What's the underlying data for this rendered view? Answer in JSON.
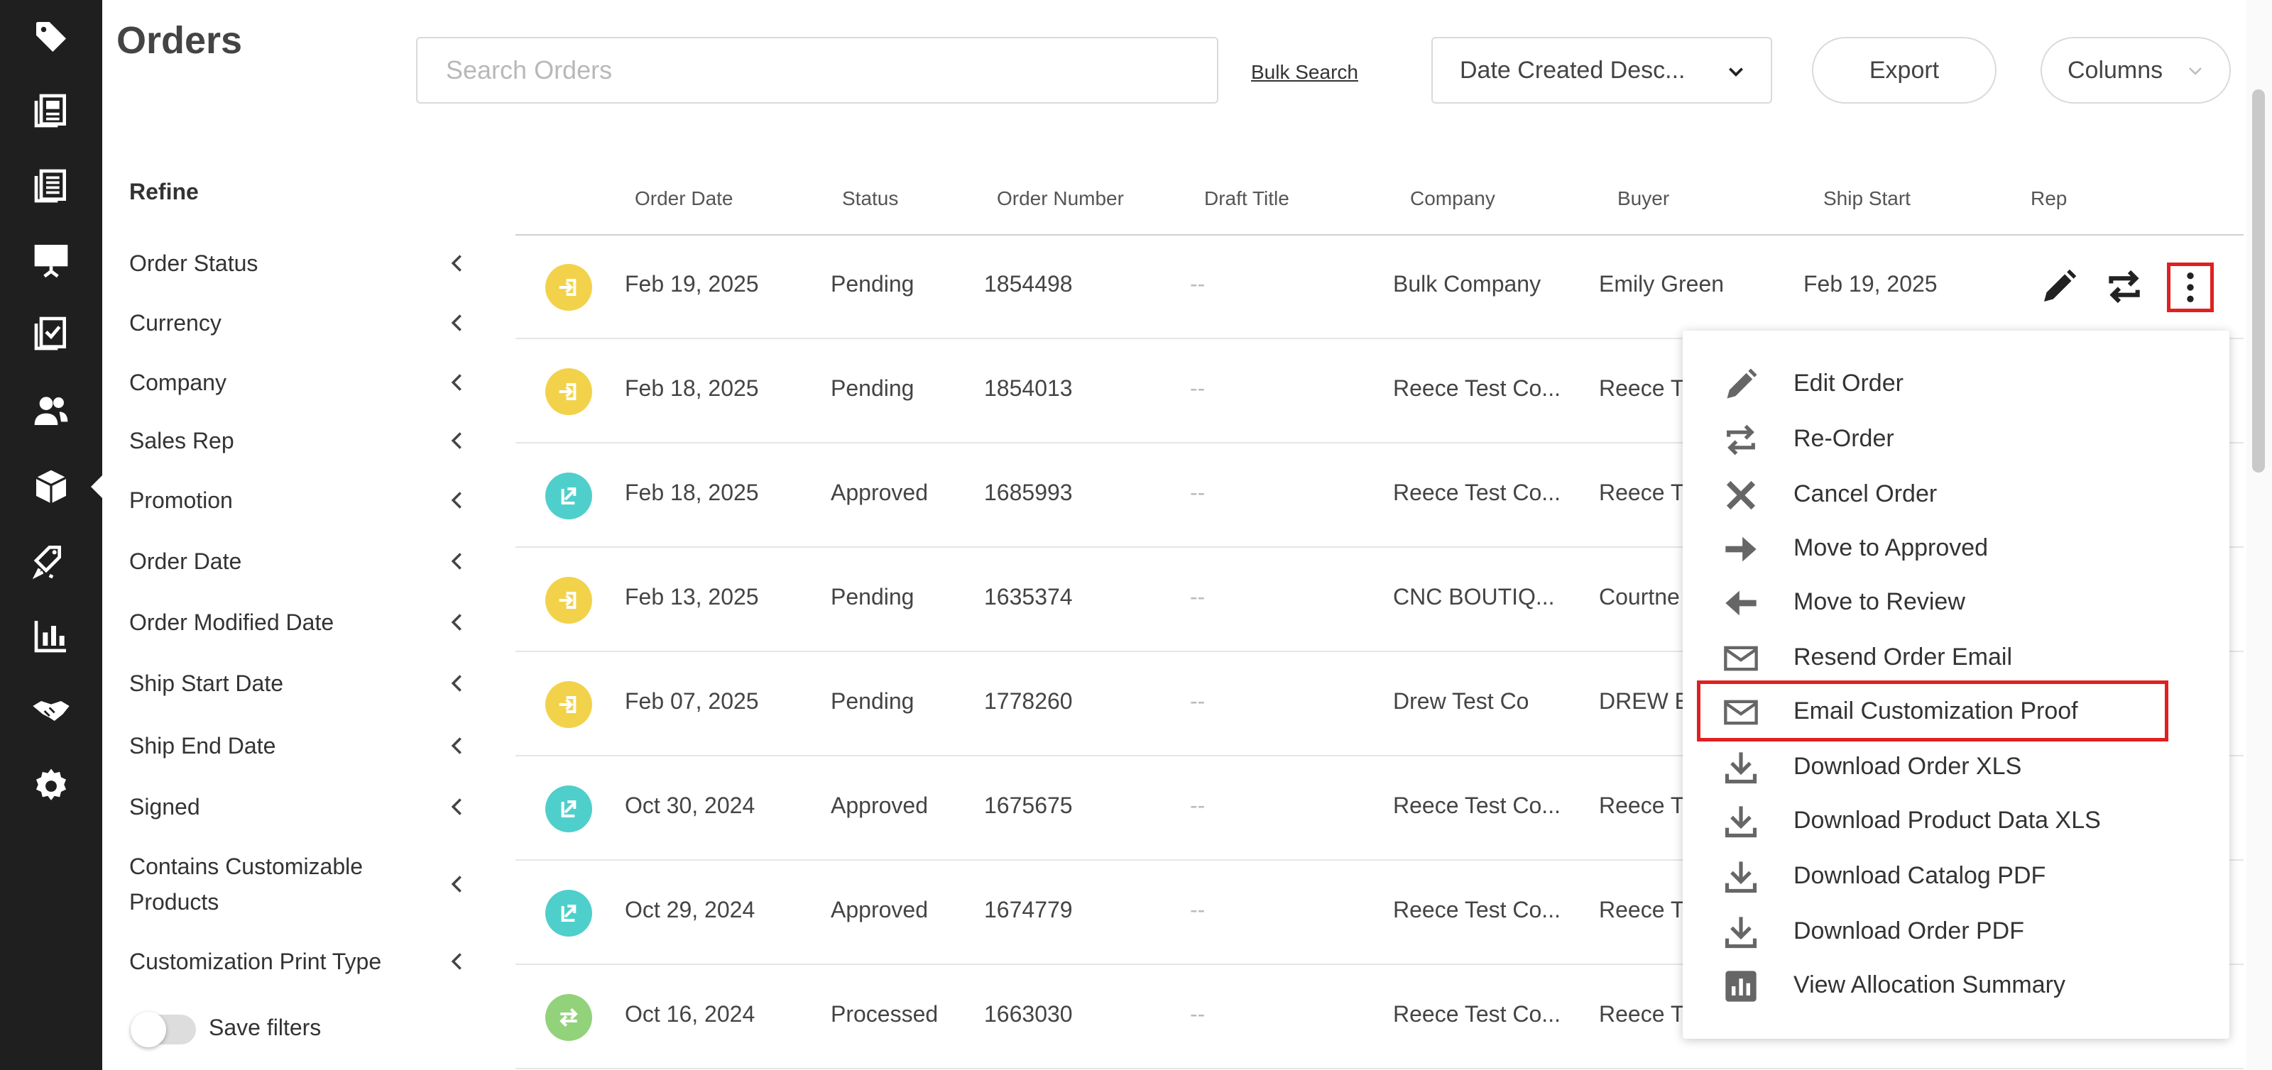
{
  "header": {
    "title": "Orders",
    "search_placeholder": "Search Orders",
    "search_value": "",
    "bulk_search": "Bulk Search",
    "sort_value": "Date Created Desc...",
    "export": "Export",
    "columns": "Columns"
  },
  "refine": {
    "title": "Refine",
    "filters": [
      "Order Status",
      "Currency",
      "Company",
      "Sales Rep",
      "Promotion",
      "Order Date",
      "Order Modified Date",
      "Ship Start Date",
      "Ship End Date",
      "Signed",
      "Contains Customizable Products",
      "Customization Print Type"
    ],
    "save_filters": "Save filters"
  },
  "table": {
    "columns": [
      "Order Date",
      "Status",
      "Order Number",
      "Draft Title",
      "Company",
      "Buyer",
      "Ship Start",
      "Rep"
    ],
    "rows": [
      {
        "status_icon": "pending-icon",
        "date": "Feb 19, 2025",
        "status": "Pending",
        "number": "1854498",
        "draft": "--",
        "company": "Bulk Company",
        "buyer": "Emily Green",
        "ship": "Feb 19, 2025"
      },
      {
        "status_icon": "pending-icon",
        "date": "Feb 18, 2025",
        "status": "Pending",
        "number": "1854013",
        "draft": "--",
        "company": "Reece Test Co...",
        "buyer": "Reece T",
        "ship": ""
      },
      {
        "status_icon": "approved-icon",
        "date": "Feb 18, 2025",
        "status": "Approved",
        "number": "1685993",
        "draft": "--",
        "company": "Reece Test Co...",
        "buyer": "Reece T",
        "ship": ""
      },
      {
        "status_icon": "pending-icon",
        "date": "Feb 13, 2025",
        "status": "Pending",
        "number": "1635374",
        "draft": "--",
        "company": "CNC BOUTIQ...",
        "buyer": "Courtne",
        "ship": ""
      },
      {
        "status_icon": "pending-icon",
        "date": "Feb 07, 2025",
        "status": "Pending",
        "number": "1778260",
        "draft": "--",
        "company": "Drew Test Co",
        "buyer": "DREW E",
        "ship": ""
      },
      {
        "status_icon": "approved-icon",
        "date": "Oct 30, 2024",
        "status": "Approved",
        "number": "1675675",
        "draft": "--",
        "company": "Reece Test Co...",
        "buyer": "Reece T",
        "ship": ""
      },
      {
        "status_icon": "approved-icon",
        "date": "Oct 29, 2024",
        "status": "Approved",
        "number": "1674779",
        "draft": "--",
        "company": "Reece Test Co...",
        "buyer": "Reece T",
        "ship": ""
      },
      {
        "status_icon": "processed-icon",
        "date": "Oct 16, 2024",
        "status": "Processed",
        "number": "1663030",
        "draft": "--",
        "company": "Reece Test Co...",
        "buyer": "Reece T",
        "ship": ""
      }
    ]
  },
  "menu": {
    "items": [
      {
        "label": "Edit Order",
        "icon": "pencil-icon"
      },
      {
        "label": "Re-Order",
        "icon": "reorder-icon"
      },
      {
        "label": "Cancel Order",
        "icon": "close-icon"
      },
      {
        "label": "Move to Approved",
        "icon": "arrow-right-icon"
      },
      {
        "label": "Move to Review",
        "icon": "arrow-left-icon"
      },
      {
        "label": "Resend Order Email",
        "icon": "mail-icon"
      },
      {
        "label": "Email Customization Proof",
        "icon": "mail-icon"
      },
      {
        "label": "Download Order XLS",
        "icon": "download-icon"
      },
      {
        "label": "Download Product Data XLS",
        "icon": "download-icon"
      },
      {
        "label": "Download Catalog PDF",
        "icon": "download-icon"
      },
      {
        "label": "Download Order PDF",
        "icon": "download-icon"
      },
      {
        "label": "View Allocation Summary",
        "icon": "bar-chart-icon"
      }
    ]
  },
  "colors": {
    "rail_bg": "#1f1f1f",
    "pending": "#f2d24a",
    "approved": "#4fcfcc",
    "processed": "#92d27a",
    "highlight": "#e02020"
  },
  "rail": {
    "icons": [
      "tag-icon",
      "catalog-icon",
      "line-sheet-icon",
      "presentation-icon",
      "checklist-icon",
      "customers-icon",
      "orders-icon",
      "promotions-icon",
      "reports-icon",
      "partners-icon",
      "settings-icon"
    ]
  }
}
